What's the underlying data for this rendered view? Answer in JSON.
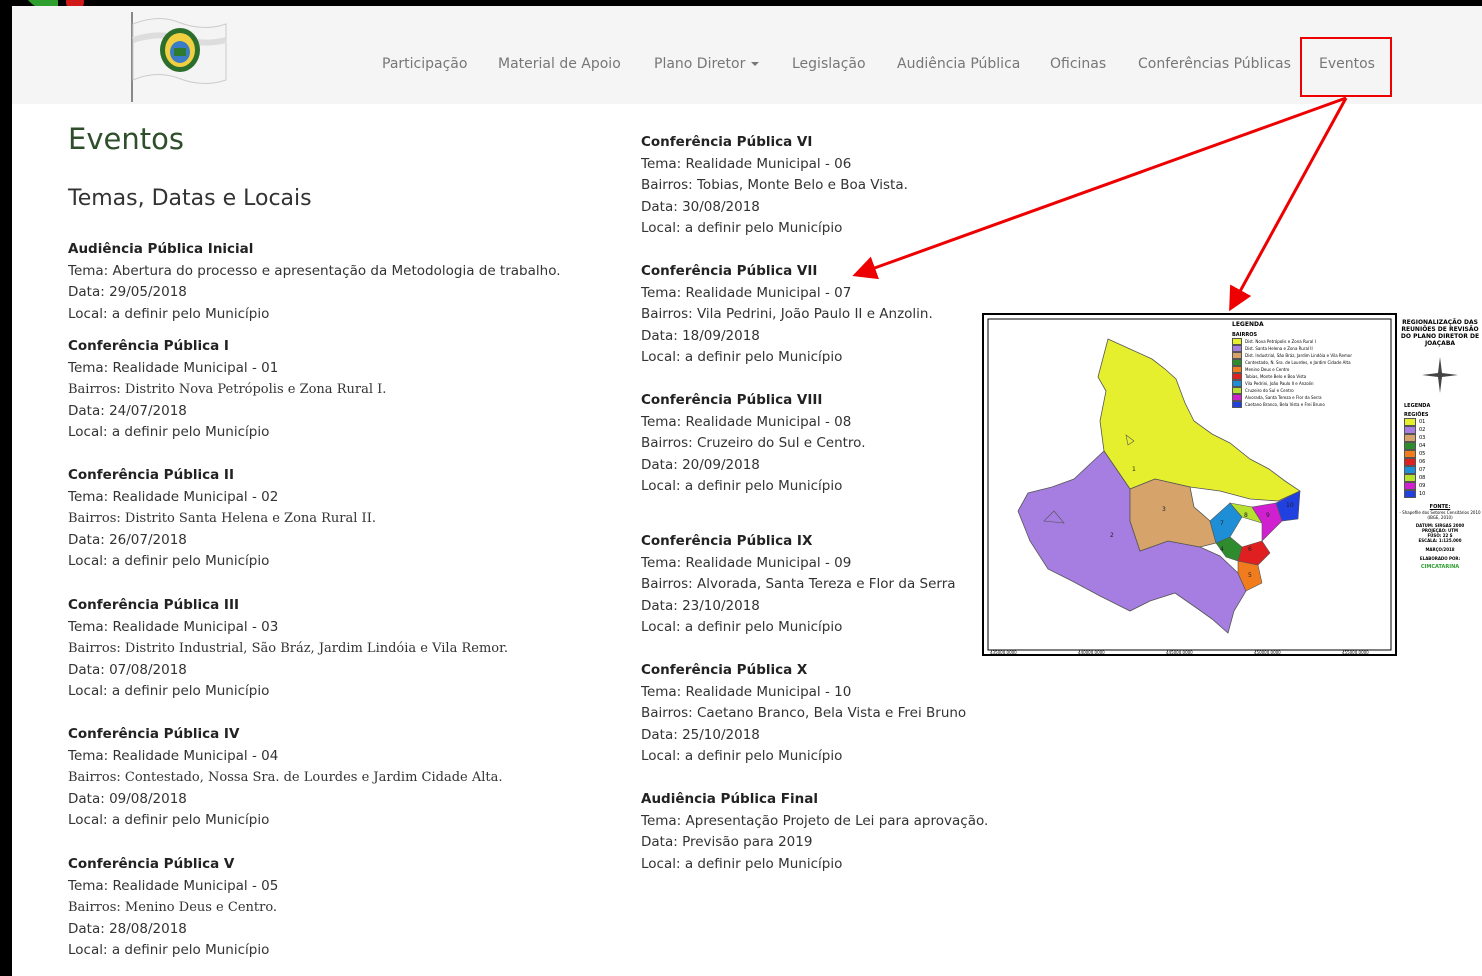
{
  "nav": {
    "items": [
      "Participação",
      "Material de Apoio",
      "Plano Diretor",
      "Legislação",
      "Audiência Pública",
      "Oficinas",
      "Conferências Públicas",
      "Eventos"
    ]
  },
  "page": {
    "title": "Eventos",
    "subtitle": "Temas, Datas e Locais"
  },
  "events_left": [
    {
      "head": "Audiência Pública Inicial",
      "tema": "Tema: Abertura do processo e apresentação da Metodologia de trabalho.",
      "bairros": "",
      "data": "Data: 29/05/2018",
      "local": "Local: a definir pelo Município"
    },
    {
      "head": "Conferência Pública I",
      "tema": "Tema: Realidade Municipal - 01",
      "bairros": "Bairros: Distrito Nova Petrópolis e Zona Rural I.",
      "data": "Data: 24/07/2018",
      "local": "Local: a definir pelo Município"
    },
    {
      "head": "Conferência Pública II",
      "tema": "Tema: Realidade Municipal - 02",
      "bairros": "Bairros: Distrito Santa Helena e Zona Rural II.",
      "data": "Data: 26/07/2018",
      "local": "Local: a definir pelo Município"
    },
    {
      "head": "Conferência Pública III",
      "tema": "Tema: Realidade Municipal - 03",
      "bairros": "Bairros: Distrito Industrial, São Bráz, Jardim Lindóia e Vila Remor.",
      "data": "Data: 07/08/2018",
      "local": "Local: a definir pelo Município"
    },
    {
      "head": "Conferência Pública IV",
      "tema": "Tema: Realidade Municipal - 04",
      "bairros": "Bairros: Contestado, Nossa Sra. de Lourdes e Jardim Cidade Alta.",
      "data": "Data: 09/08/2018",
      "local": "Local: a definir pelo Município"
    },
    {
      "head": "Conferência Pública V",
      "tema": "Tema: Realidade Municipal - 05",
      "bairros": "Bairros: Menino Deus e Centro.",
      "data": "Data: 28/08/2018",
      "local": "Local: a definir pelo Município"
    }
  ],
  "events_right": [
    {
      "head": "Conferência Pública VI",
      "tema": "Tema: Realidade Municipal - 06",
      "bairros": "Bairros: Tobias, Monte Belo e Boa Vista.",
      "data": "Data: 30/08/2018",
      "local": "Local: a definir pelo Município"
    },
    {
      "head": "Conferência Pública VII",
      "tema": "Tema: Realidade Municipal - 07",
      "bairros": "Bairros: Vila Pedrini, João Paulo II e Anzolin.",
      "data": "Data: 18/09/2018",
      "local": "Local: a definir pelo Município"
    },
    {
      "head": "Conferência Pública VIII",
      "tema": "Tema: Realidade Municipal - 08",
      "bairros": "Bairros: Cruzeiro do Sul e Centro.",
      "data": "Data: 20/09/2018",
      "local": "Local: a definir pelo Município"
    },
    {
      "head": "Conferência Pública IX",
      "tema": "Tema: Realidade Municipal - 09",
      "bairros": "Bairros: Alvorada, Santa Tereza e Flor da Serra",
      "data": "Data: 23/10/2018",
      "local": "Local: a definir pelo Município"
    },
    {
      "head": "Conferência Pública X",
      "tema": "Tema: Realidade Municipal - 10",
      "bairros": "Bairros: Caetano Branco, Bela Vista e Frei Bruno",
      "data": "Data: 25/10/2018",
      "local": "Local: a definir pelo Município"
    },
    {
      "head": "Audiência Pública Final",
      "tema": "Tema: Apresentação Projeto de Lei para aprovação.",
      "bairros": "",
      "data": "Data: Previsão para 2019",
      "local": "Local: a definir pelo Município"
    }
  ],
  "map": {
    "legend_title": "LEGENDA",
    "bairros_title": "BAIRROS",
    "bairros": [
      "Dist. Nova Petrópolis e Zona Rural I",
      "Dist. Santa Helena e Zona Rural II",
      "Dist. Industrial, São Bráz, Jardim Lindóia e Vila Remor",
      "Contestado, N. Sra. de Lourdes, e Jardim Cidade Alta",
      "Menino Deus e Centro",
      "Tobias, Monte Belo e Boa Vista",
      "Vila Pedrini, João Paulo II e Anzolin",
      "Cruzeiro do Sul e Centro",
      "Alvorada, Santa Tereza e Flor da Serra",
      "Caetano Branco, Bela Vista e Frei Bruno"
    ],
    "region_colors": [
      "#e6ef2e",
      "#a67de0",
      "#d6a46a",
      "#2e8b2e",
      "#f07c1e",
      "#e02020",
      "#1e8fd6",
      "#b8e02e",
      "#d020d0",
      "#2040e0"
    ],
    "side_title": "REGIONALIZAÇÃO DAS REUNIÕES DE REVISÃO DO PLANO DIRETOR DE JOAÇABA",
    "side_legend": "LEGENDA",
    "side_regioes": "REGIÕES",
    "region_codes": [
      "01",
      "02",
      "03",
      "04",
      "05",
      "06",
      "07",
      "08",
      "09",
      "10"
    ],
    "fonte_title": "FONTE:",
    "fonte_text": "- Shapefile dos Setores Censitários 2010 (IBGE, 2010)",
    "datum_lines": [
      "DATUM: SIRGAS 2000",
      "PROJEÇÃO: UTM",
      "FUSO: 22 S",
      "ESCALA: 1:125.000"
    ],
    "date": "MARÇO/2018",
    "elaborado": "ELABORADO POR:",
    "org": "CIMCATARINA",
    "x_ticks": [
      "435000.0000",
      "440000.0000",
      "445000.0000",
      "450000.0000",
      "455000.0000"
    ],
    "region_labels": [
      "1",
      "2",
      "3",
      "4",
      "5",
      "6",
      "7",
      "8",
      "9",
      "10"
    ]
  }
}
